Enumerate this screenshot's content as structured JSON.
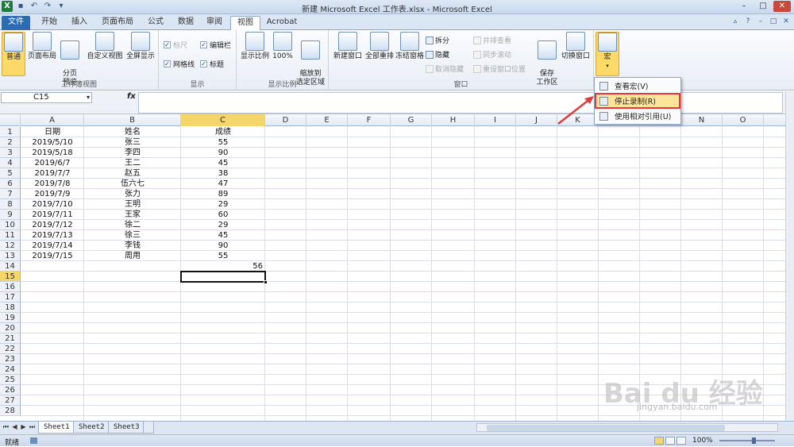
{
  "window": {
    "title": "新建 Microsoft Excel 工作表.xlsx - Microsoft Excel"
  },
  "tabs": [
    {
      "label": "文件"
    },
    {
      "label": "开始"
    },
    {
      "label": "插入"
    },
    {
      "label": "页面布局"
    },
    {
      "label": "公式"
    },
    {
      "label": "数据"
    },
    {
      "label": "审阅"
    },
    {
      "label": "视图"
    },
    {
      "label": "Acrobat"
    }
  ],
  "ribbon": {
    "workbook_views": {
      "group_label": "工作簿视图",
      "normal": "普通",
      "page_layout": "页面布局",
      "page_break": "分页\n预览",
      "custom_views": "自定义视图",
      "full_screen": "全屏显示"
    },
    "show": {
      "group_label": "显示",
      "ruler": "标尺",
      "formula_bar": "编辑栏",
      "gridlines": "网格线",
      "headings": "标题"
    },
    "zoom": {
      "group_label": "显示比例",
      "zoom": "显示比例",
      "zoom100": "100%",
      "zoom_selection": "缩放到\n选定区域"
    },
    "window": {
      "group_label": "窗口",
      "new_window": "新建窗口",
      "arrange_all": "全部重排",
      "freeze_panes": "冻结窗格",
      "split": "拆分",
      "hide": "隐藏",
      "unhide": "取消隐藏",
      "side_by_side": "并排查看",
      "sync_scroll": "同步滚动",
      "reset_position": "重设窗口位置",
      "save_workspace": "保存\n工作区",
      "switch_windows": "切换窗口"
    },
    "macros": {
      "label": "宏"
    }
  },
  "name_box": "C15",
  "fx_symbol": "fx",
  "columns": [
    "A",
    "B",
    "C",
    "D",
    "E",
    "F",
    "G",
    "H",
    "I",
    "J",
    "K",
    "L",
    "M",
    "N",
    "O"
  ],
  "row_numbers": [
    "1",
    "2",
    "3",
    "4",
    "5",
    "6",
    "7",
    "8",
    "9",
    "10",
    "11",
    "12",
    "13",
    "14",
    "15",
    "16",
    "17",
    "18",
    "19",
    "20",
    "21",
    "22",
    "23",
    "24",
    "25",
    "26",
    "27",
    "28"
  ],
  "table": {
    "headers": [
      "日期",
      "姓名",
      "成绩"
    ],
    "rows": [
      [
        "2019/5/10",
        "张三",
        "55"
      ],
      [
        "2019/5/18",
        "李四",
        "90"
      ],
      [
        "2019/6/7",
        "王二",
        "45"
      ],
      [
        "2019/7/7",
        "赵五",
        "38"
      ],
      [
        "2019/7/8",
        "伍六七",
        "47"
      ],
      [
        "2019/7/9",
        "张力",
        "89"
      ],
      [
        "2019/7/10",
        "王明",
        "29"
      ],
      [
        "2019/7/11",
        "王家",
        "60"
      ],
      [
        "2019/7/12",
        "徐二",
        "29"
      ],
      [
        "2019/7/13",
        "徐三",
        "45"
      ],
      [
        "2019/7/14",
        "李钱",
        "90"
      ],
      [
        "2019/7/15",
        "周用",
        "55"
      ]
    ]
  },
  "c14_value": "56",
  "sheets": [
    "Sheet1",
    "Sheet2",
    "Sheet3"
  ],
  "status": {
    "ready": "就绪",
    "zoom": "100%"
  },
  "macro_menu": {
    "view_macros": "查看宏(V)",
    "stop_recording": "停止录制(R)",
    "relative_refs": "使用相对引用(U)"
  },
  "watermark": {
    "brand": "Bai du 经验",
    "url": "jingyan.baidu.com"
  },
  "colors": {
    "accent": "#2b6cb3",
    "highlight": "#f5d66a",
    "annotation": "#e03a3a"
  }
}
